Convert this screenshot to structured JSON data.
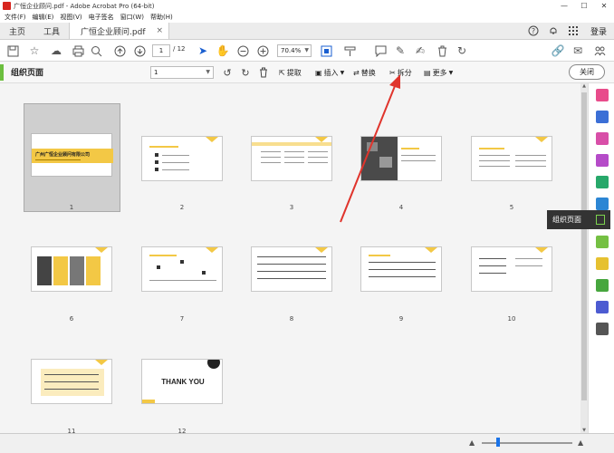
{
  "window": {
    "title": "广恒企业顾问.pdf - Adobe Acrobat Pro (64-bit)",
    "minimize": "—",
    "maximize": "☐",
    "close": "✕"
  },
  "menu": [
    "文件(F)",
    "编辑(E)",
    "视图(V)",
    "电子签名",
    "窗口(W)",
    "帮助(H)"
  ],
  "tabs": {
    "home": "主页",
    "tools": "工具",
    "doc": "广恒企业顾问.pdf",
    "doc_close": "×",
    "login": "登录"
  },
  "toolbar": {
    "page_current": "1",
    "page_total": "/ 12",
    "zoom": "70.4%"
  },
  "organize": {
    "title": "组织页面",
    "range_value": "1",
    "extract": "提取",
    "insert": "插入",
    "replace": "替换",
    "split": "拆分",
    "more": "更多",
    "close": "关闭"
  },
  "slides": {
    "s1_title": "广州广恒企业顾问有限公司",
    "s12_text": "THANK YOU"
  },
  "pages": [
    {
      "num": "1"
    },
    {
      "num": "2"
    },
    {
      "num": "3"
    },
    {
      "num": "4"
    },
    {
      "num": "5"
    },
    {
      "num": "6"
    },
    {
      "num": "7"
    },
    {
      "num": "8"
    },
    {
      "num": "9"
    },
    {
      "num": "10"
    },
    {
      "num": "11"
    },
    {
      "num": "12"
    }
  ],
  "tooltip": "组织页面",
  "colors": {
    "accent_yellow": "#f3c845",
    "acrobat_red": "#d7261f",
    "organize_green": "#6cbf3f",
    "arrow_red": "#e0342c"
  }
}
